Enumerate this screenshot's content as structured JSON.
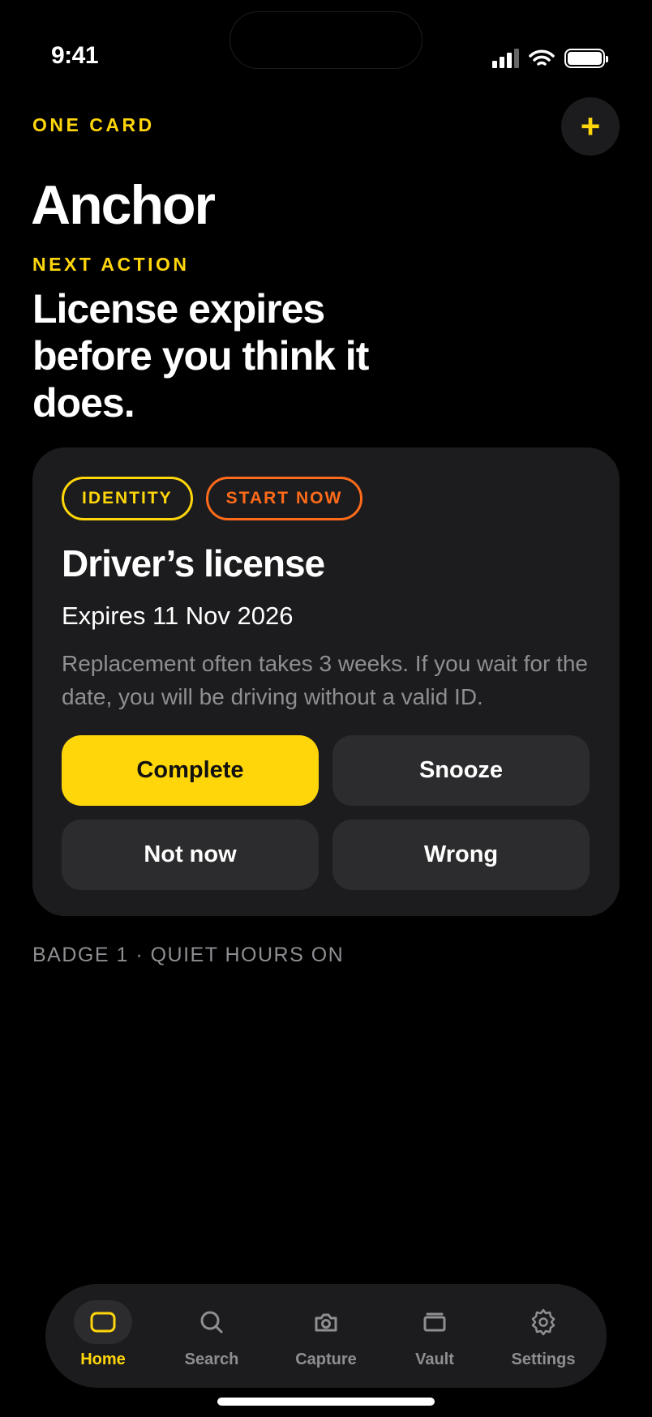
{
  "status_bar": {
    "time": "9:41"
  },
  "header": {
    "eyebrow": "ONE CARD",
    "add_label": "+",
    "title": "Anchor",
    "next_label": "NEXT ACTION",
    "headline": "License expires before you think it does."
  },
  "card": {
    "chips": [
      "IDENTITY",
      "START NOW"
    ],
    "title": "Driver’s license",
    "expiry": "Expires 11 Nov 2026",
    "description": "Replacement often takes 3 weeks. If you wait for the date, you will be driving without a valid ID.",
    "actions": {
      "complete": "Complete",
      "snooze": "Snooze",
      "not_now": "Not now",
      "wrong": "Wrong"
    }
  },
  "footnote": "BADGE 1 · QUIET HOURS ON",
  "tabs": [
    {
      "label": "Home",
      "icon": "home-icon",
      "active": true
    },
    {
      "label": "Search",
      "icon": "search-icon",
      "active": false
    },
    {
      "label": "Capture",
      "icon": "camera-icon",
      "active": false
    },
    {
      "label": "Vault",
      "icon": "vault-icon",
      "active": false
    },
    {
      "label": "Settings",
      "icon": "gear-icon",
      "active": false
    }
  ],
  "colors": {
    "accent": "#FFD60A",
    "warning": "#FF6B1A",
    "surface": "#1C1C1E",
    "muted": "#8E8E93"
  }
}
